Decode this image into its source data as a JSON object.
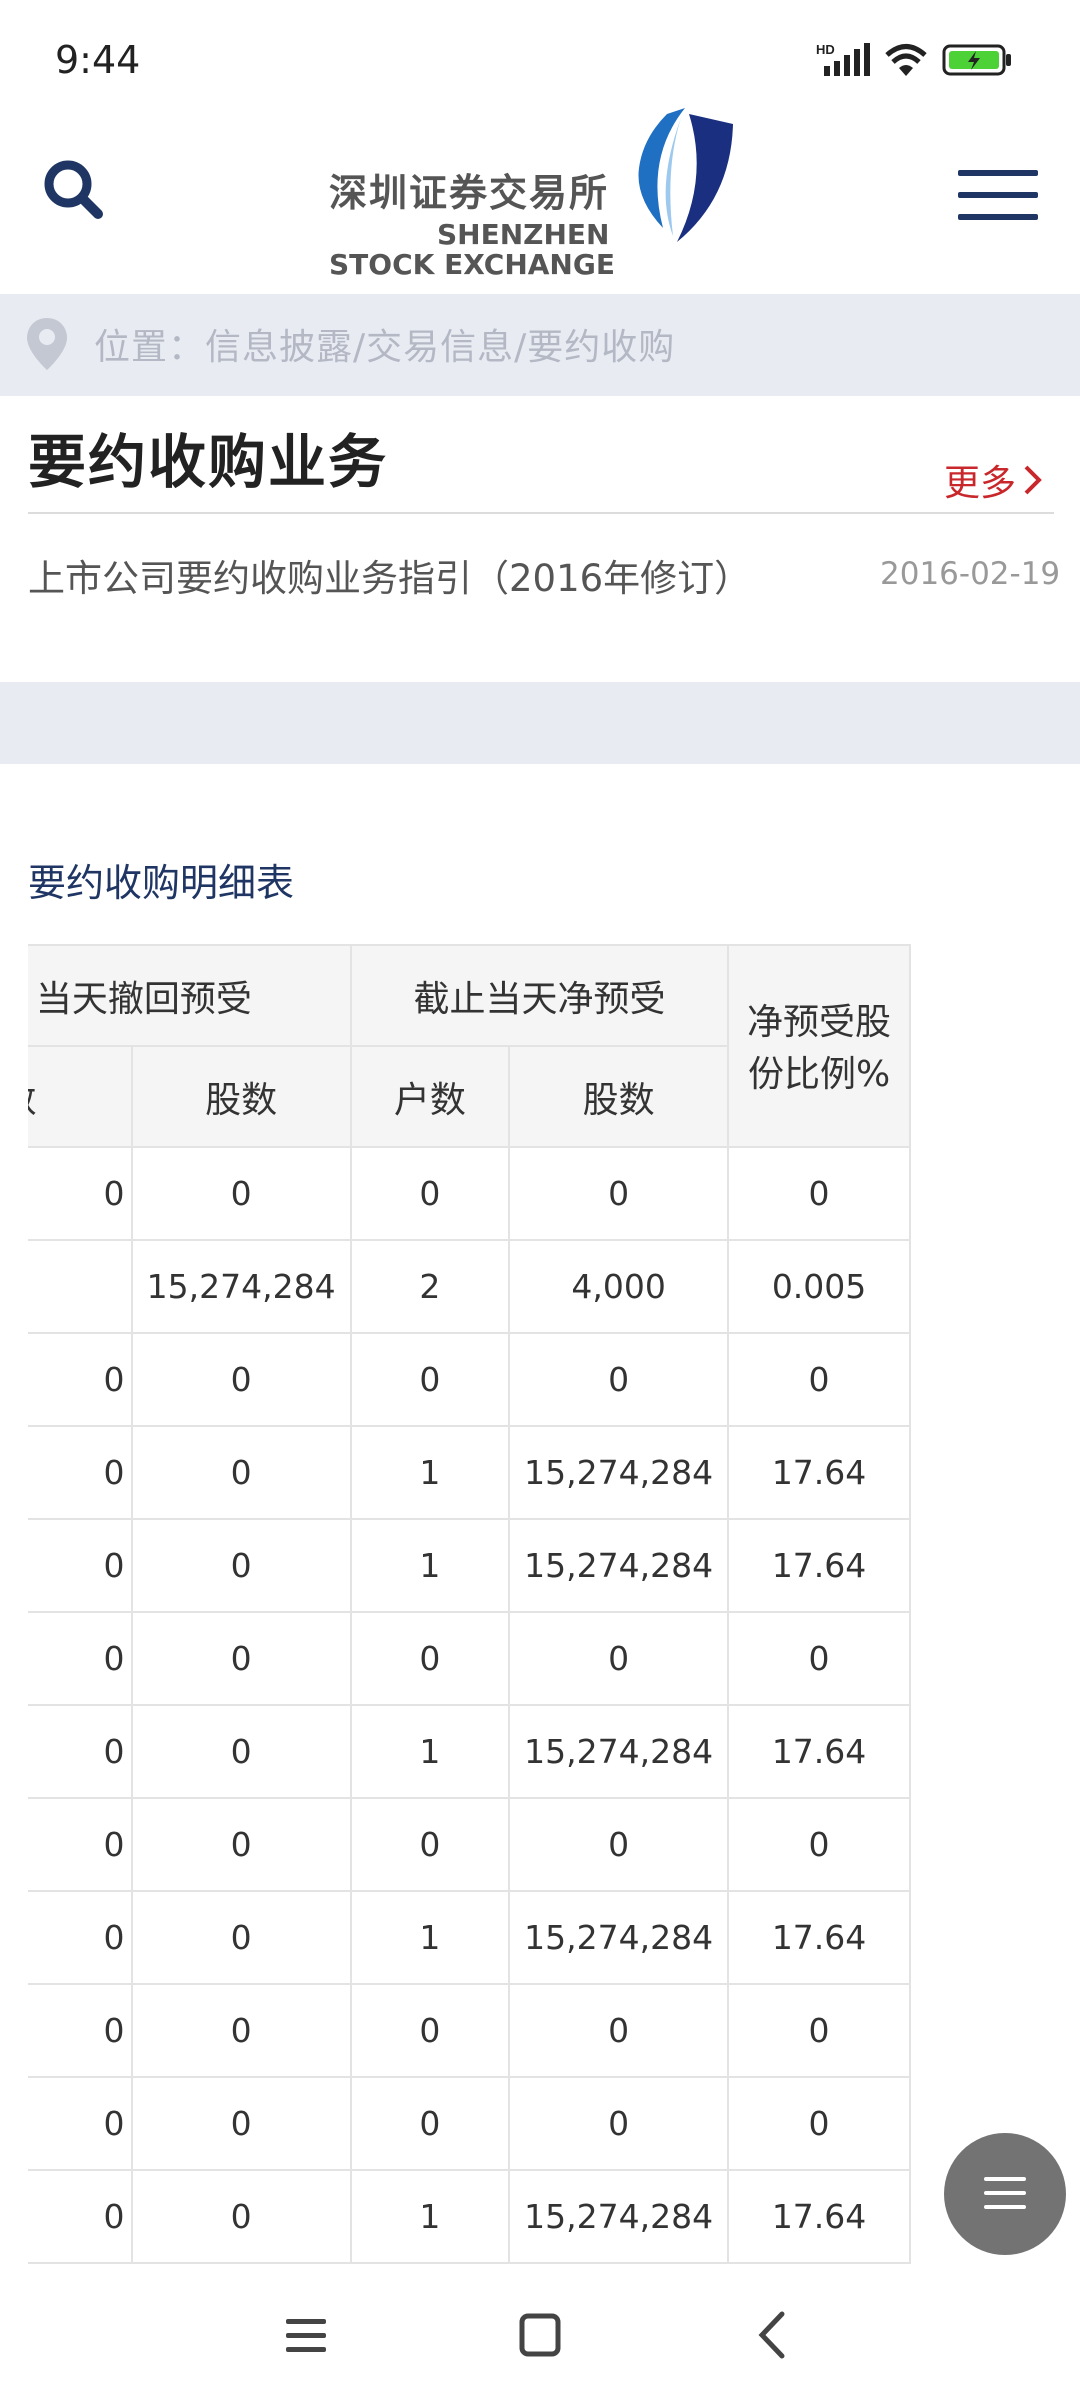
{
  "status_bar": {
    "time": "9:44",
    "hd_label": "HD"
  },
  "header": {
    "logo_cn": "深圳证券交易所",
    "logo_en_line1": "SHENZHEN",
    "logo_en_line2": "STOCK EXCHANGE",
    "brand_color": "#1f3564"
  },
  "breadcrumb": {
    "text": "位置：信息披露/交易信息/要约收购"
  },
  "section": {
    "title": "要约收购业务",
    "more_label": "更多",
    "items": [
      {
        "title": "上市公司要约收购业务指引（2016年修订）",
        "date": "2016-02-19"
      }
    ]
  },
  "table": {
    "title": "要约收购明细表",
    "group_headers": [
      "当天撤回预受",
      "截止当天净预受",
      "净预受股份比例%"
    ],
    "sub_headers": [
      "户数",
      "股数",
      "户数",
      "股数"
    ],
    "rows": [
      [
        "0",
        "0",
        "0",
        "0",
        "0"
      ],
      [
        "",
        "15,274,284",
        "2",
        "4,000",
        "0.005"
      ],
      [
        "0",
        "0",
        "0",
        "0",
        "0"
      ],
      [
        "0",
        "0",
        "1",
        "15,274,284",
        "17.64"
      ],
      [
        "0",
        "0",
        "1",
        "15,274,284",
        "17.64"
      ],
      [
        "0",
        "0",
        "0",
        "0",
        "0"
      ],
      [
        "0",
        "0",
        "1",
        "15,274,284",
        "17.64"
      ],
      [
        "0",
        "0",
        "0",
        "0",
        "0"
      ],
      [
        "0",
        "0",
        "1",
        "15,274,284",
        "17.64"
      ],
      [
        "0",
        "0",
        "0",
        "0",
        "0"
      ],
      [
        "0",
        "0",
        "0",
        "0",
        "0"
      ],
      [
        "0",
        "0",
        "1",
        "15,274,284",
        "17.64"
      ]
    ]
  }
}
